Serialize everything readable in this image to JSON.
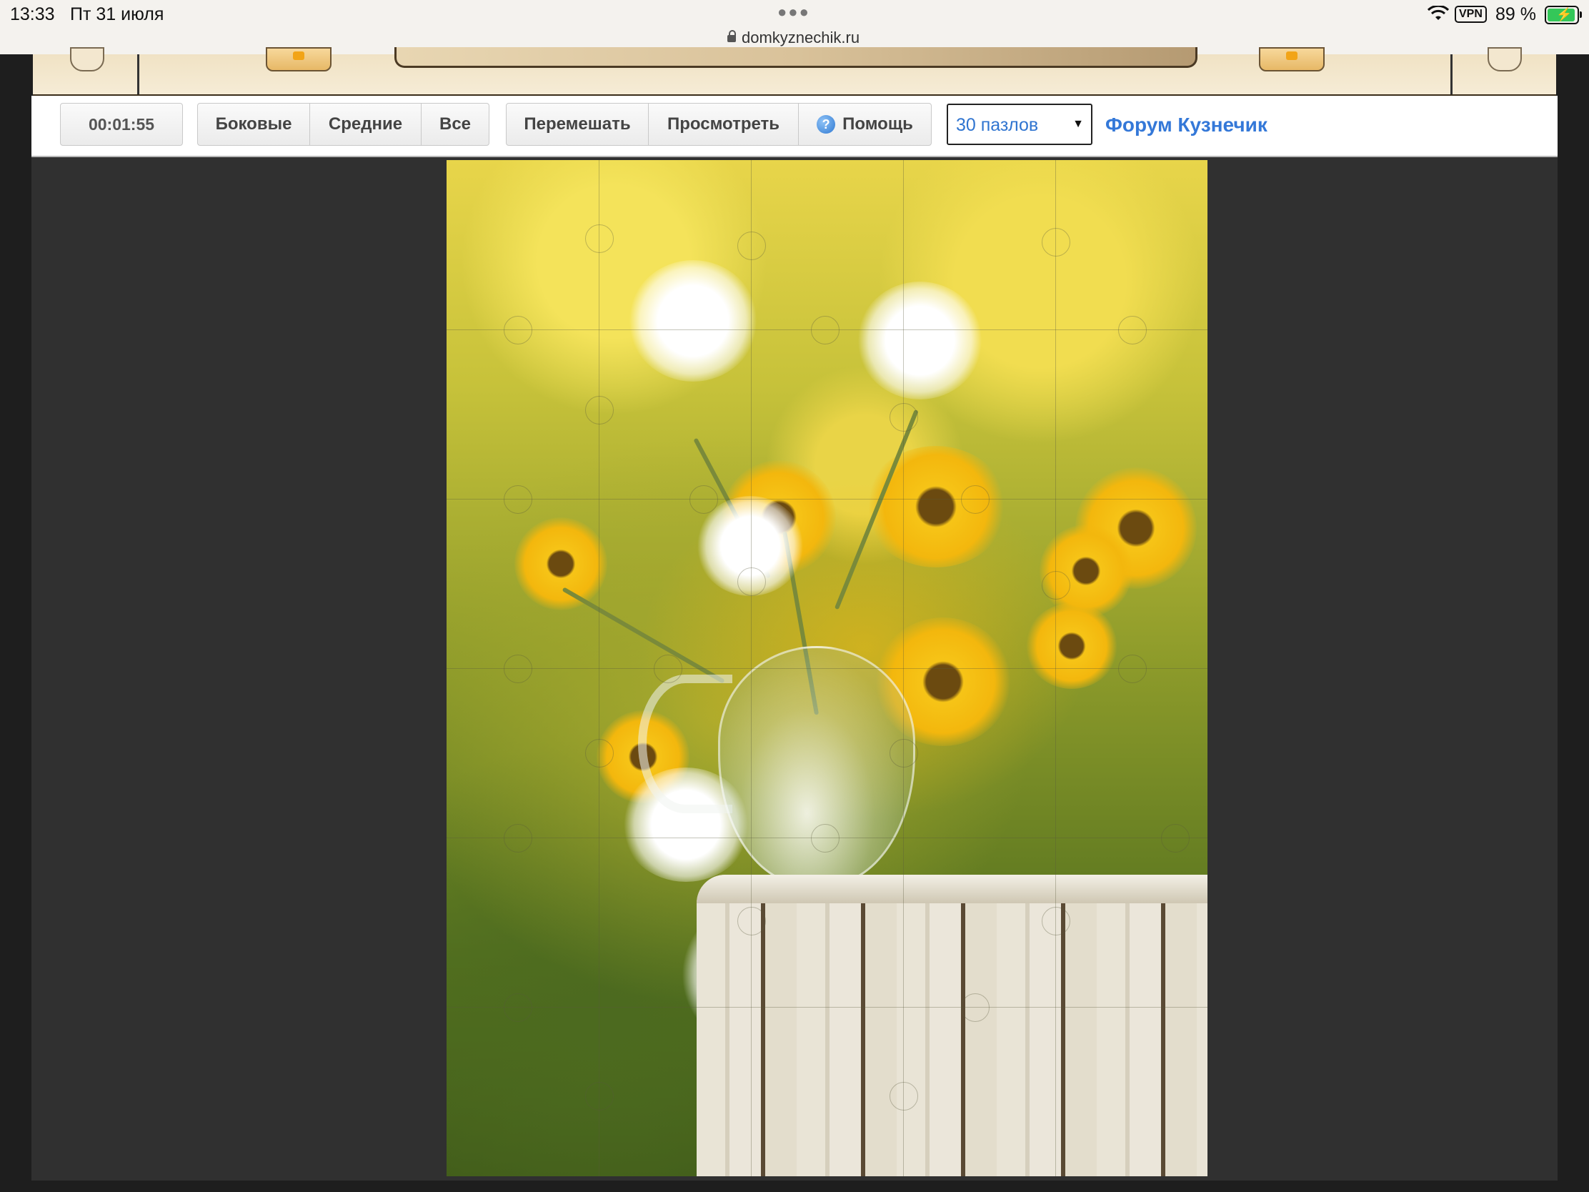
{
  "status_bar": {
    "time": "13:33",
    "date": "Пт 31 июля",
    "url": "domkyznechik.ru",
    "vpn": "VPN",
    "battery_percent": "89 %"
  },
  "toolbar": {
    "timer": "00:01:55",
    "filter_buttons": [
      "Боковые",
      "Средние",
      "Все"
    ],
    "action_buttons": {
      "shuffle": "Перемешать",
      "preview": "Просмотреть",
      "help": "Помощь"
    },
    "puzzle_count": {
      "selected": "30 пазлов"
    },
    "forum_link": "Форум Кузнечик"
  },
  "puzzle": {
    "pieces": 30,
    "columns": 5,
    "rows": 6,
    "image_description": "dandelions in a glass jug on a birch stump"
  },
  "colors": {
    "accent_link": "#3478d8",
    "workarea_bg": "#303030",
    "battery": "#34c759"
  }
}
